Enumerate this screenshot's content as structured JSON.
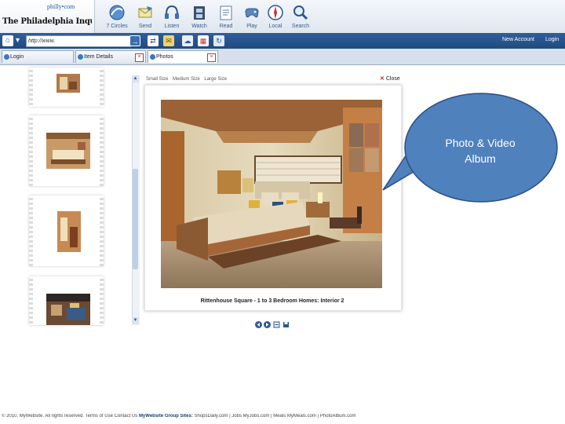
{
  "brand": {
    "philly": "philly",
    "philly_suffix": "com",
    "name": "The Philadelphia Inquirer"
  },
  "nav": [
    {
      "label": "7 Circles",
      "icon": "circles-icon"
    },
    {
      "label": "Send",
      "icon": "send-icon"
    },
    {
      "label": "Listen",
      "icon": "headphones-icon"
    },
    {
      "label": "Watch",
      "icon": "film-icon"
    },
    {
      "label": "Read",
      "icon": "document-icon"
    },
    {
      "label": "Play",
      "icon": "gamepad-icon"
    },
    {
      "label": "Local",
      "icon": "compass-icon"
    },
    {
      "label": "Search",
      "icon": "magnifier-icon"
    }
  ],
  "addressbar": {
    "url": "http://www.",
    "new_account": "New Account",
    "login": "Login"
  },
  "tabs": [
    {
      "label": "Login"
    },
    {
      "label": "Item Details"
    },
    {
      "label": "Photos"
    }
  ],
  "viewer": {
    "sizes": [
      "Small Size",
      "Medium Size",
      "Large Size"
    ],
    "close": "Close",
    "caption": "Rittenhouse Square - 1 to 3 Bedroom Homes: Interior 2"
  },
  "callout": {
    "line1": "Photo & Video",
    "line2": "Album"
  },
  "footer": {
    "left": "© 2010, MyWebsite. All rights reserved.   Terms of Use   Contact Us  ",
    "brand": "MyWebsite Group Sites:",
    "right": " ShopsDaily.com | Jobs MyJobs.com | Meals MyMeals.com | PhotoAlbum.com"
  },
  "colors": {
    "address_bar": "#2a5690",
    "callout_fill": "#4f81bd",
    "callout_stroke": "#2a4f85"
  }
}
